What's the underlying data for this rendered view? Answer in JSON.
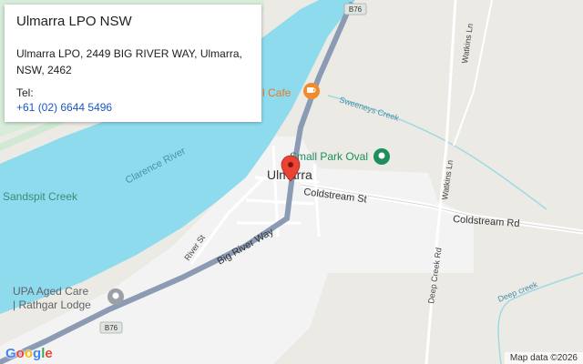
{
  "info_card": {
    "title": "Ulmarra LPO NSW",
    "address": "Ulmarra LPO, 2449 BIG RIVER WAY, Ulmarra, NSW, 2462",
    "tel_label": "Tel:",
    "tel_value": "+61 (02) 6644 5496"
  },
  "map": {
    "town_label": "Ulmarra",
    "river_label": "Clarence River",
    "creek_label": "Sandspit Creek",
    "sweeneys_creek": "Sweeneys Creek",
    "deep_creek_lower": "Deep creek",
    "big_river_way": "Big River Way",
    "river_st": "River St",
    "coldstream_st": "Coldstream St",
    "coldstream_rd": "Coldstream Rd",
    "deep_creek_rd": "Deep Creek Rd",
    "watkins_ln_top": "Watkins Ln",
    "watkins_ln_mid": "Watkins Ln",
    "cafe_label": "l Cafe",
    "small_park_oval": "Small Park Oval",
    "upa_line1": "UPA Aged Care",
    "upa_line2": "| Rathgar Lodge",
    "shield_top": "B76",
    "shield_bottom": "B76",
    "attribution": "Map data ©2026",
    "logo": {
      "letters": [
        "G",
        "o",
        "o",
        "g",
        "l",
        "e"
      ],
      "colors": [
        "#4285F4",
        "#EA4335",
        "#FBBC05",
        "#4285F4",
        "#34A853",
        "#EA4335"
      ]
    }
  },
  "colors": {
    "water": "#8fdbee",
    "land": "#eceae4",
    "urban": "#f2f2f2",
    "park": "#cfe9d4",
    "highway": "#8a9bb3",
    "marker": "#ea4335",
    "cafe": "#f28b2b",
    "park_poi": "#1e8e5a",
    "care_poi": "#9aa0a6"
  }
}
